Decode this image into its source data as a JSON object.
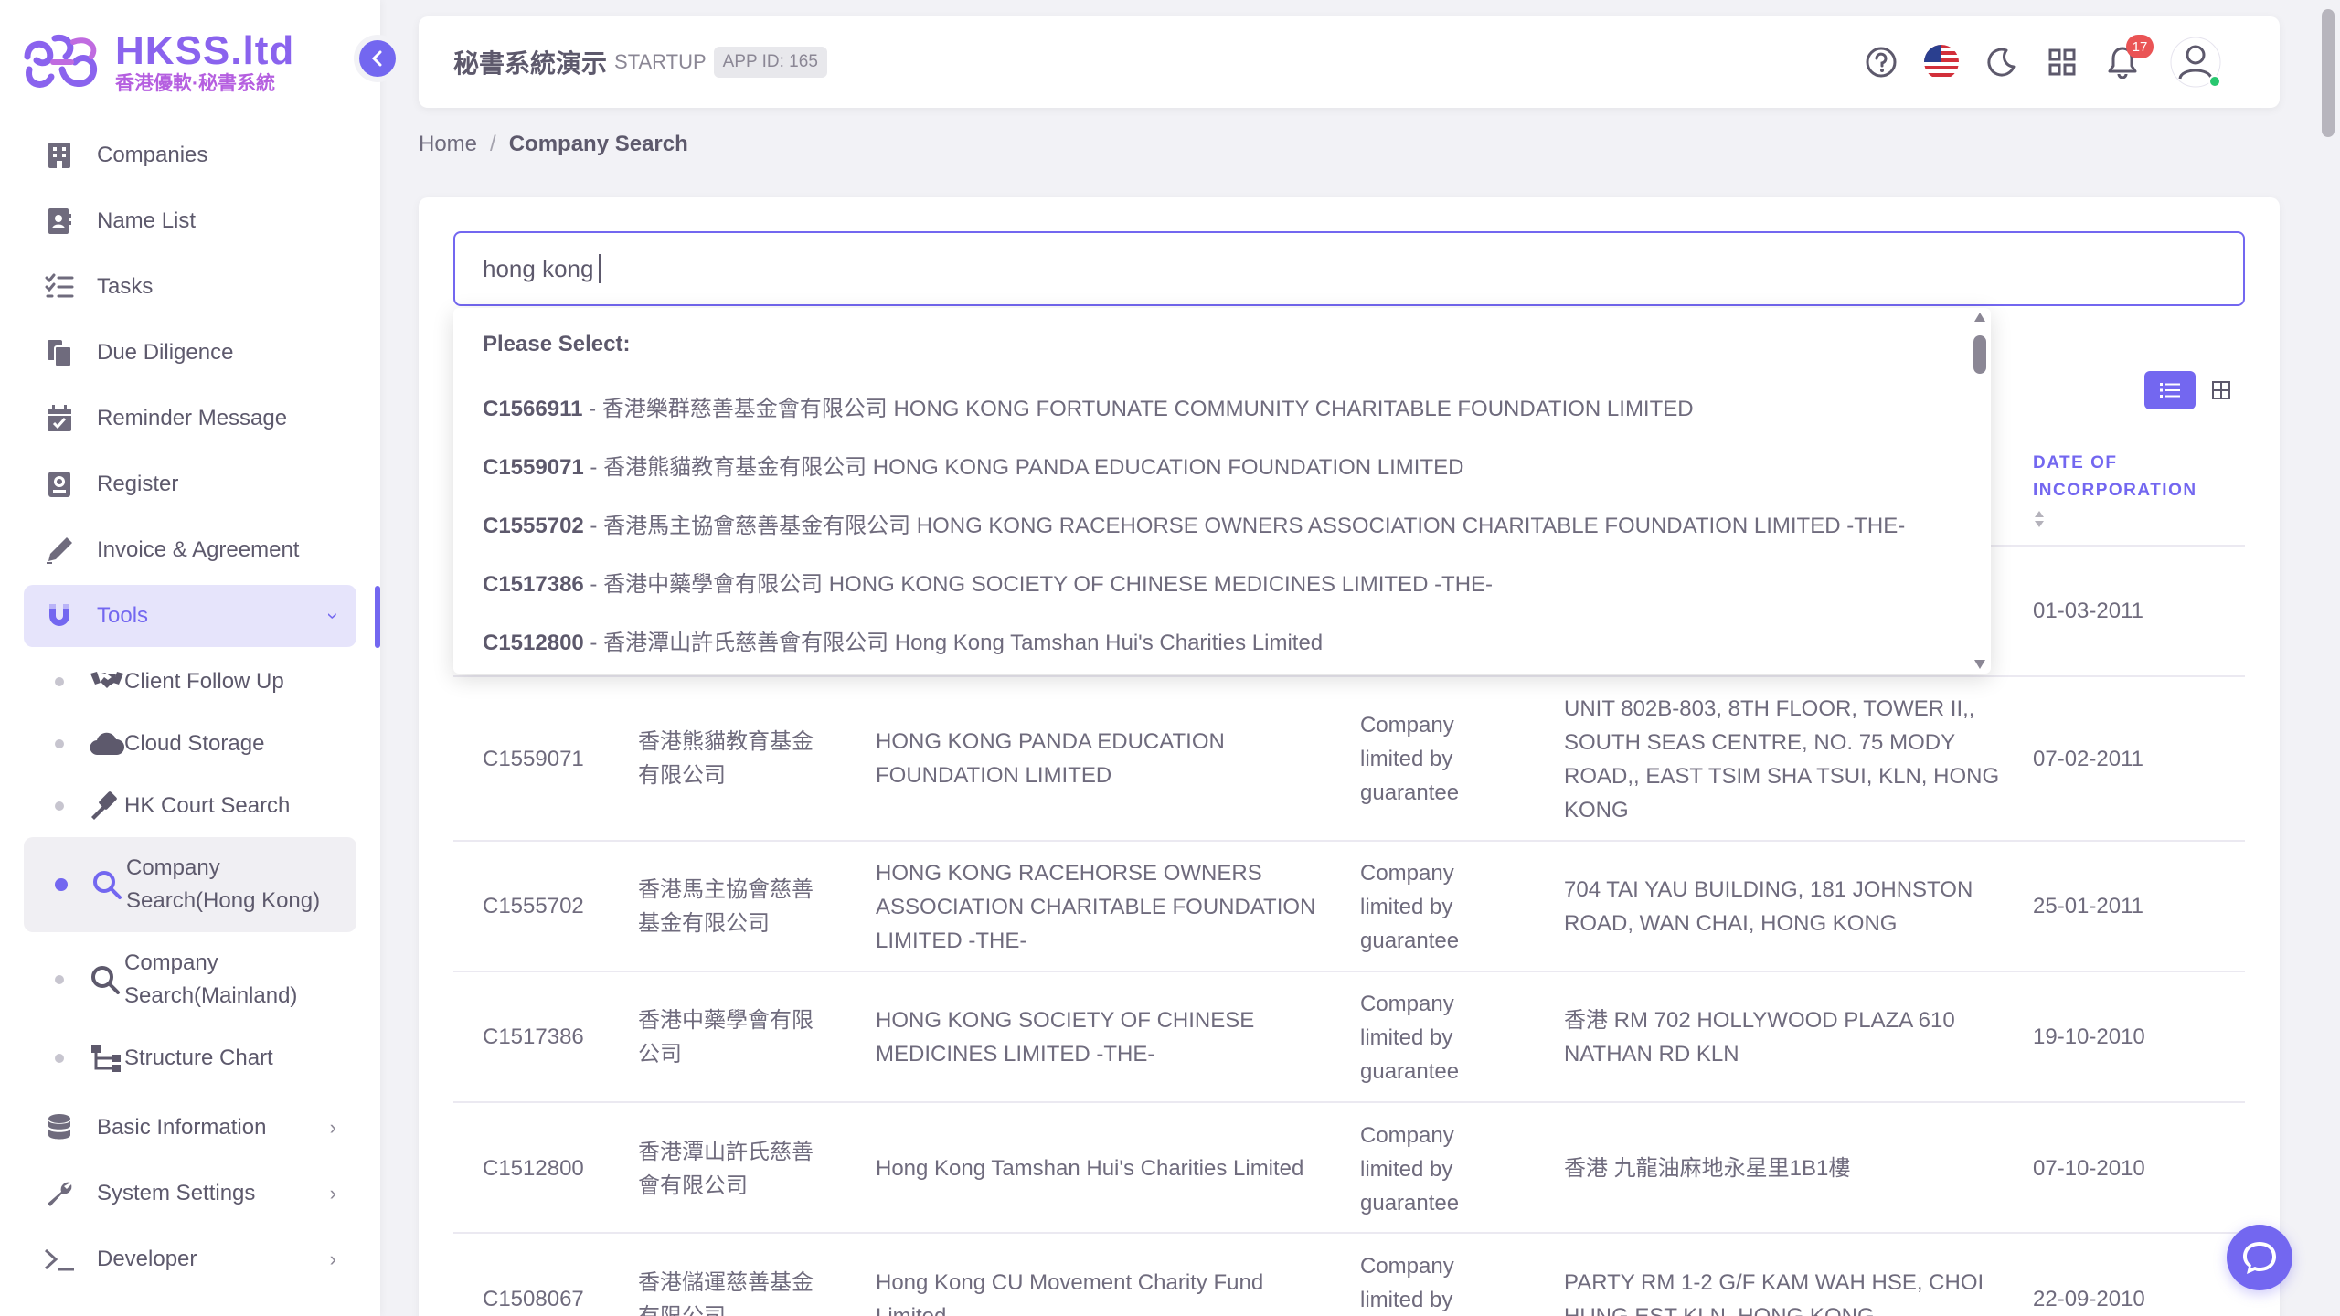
{
  "logo": {
    "title": "HKSS.ltd",
    "subtitle": "香港優軟·秘書系統"
  },
  "sidebar": {
    "items": [
      {
        "label": "Companies",
        "icon": "building-icon"
      },
      {
        "label": "Name List",
        "icon": "contact-card-icon"
      },
      {
        "label": "Tasks",
        "icon": "checklist-icon"
      },
      {
        "label": "Due Diligence",
        "icon": "documents-icon"
      },
      {
        "label": "Reminder Message",
        "icon": "calendar-check-icon"
      },
      {
        "label": "Register",
        "icon": "register-icon"
      },
      {
        "label": "Invoice & Agreement",
        "icon": "pen-icon"
      },
      {
        "label": "Tools",
        "icon": "magnet-icon"
      }
    ],
    "tools_sub": [
      {
        "label": "Client Follow Up",
        "icon": "handshake-icon"
      },
      {
        "label": "Cloud Storage",
        "icon": "cloud-icon"
      },
      {
        "label": "HK Court Search",
        "icon": "gavel-icon"
      },
      {
        "label_line1": "Company",
        "label_line2": "Search(Hong Kong)",
        "icon": "search-icon"
      },
      {
        "label_line1": "Company",
        "label_line2": "Search(Mainland)",
        "icon": "search-icon"
      },
      {
        "label": "Structure Chart",
        "icon": "sitemap-icon"
      }
    ],
    "bottom": [
      {
        "label": "Basic Information",
        "icon": "database-icon"
      },
      {
        "label": "System Settings",
        "icon": "wrench-icon"
      },
      {
        "label": "Developer",
        "icon": "terminal-icon"
      }
    ]
  },
  "topbar": {
    "title": "秘書系統演示",
    "plan": "STARTUP",
    "app_id": "APP ID: 165",
    "notifications": "17"
  },
  "breadcrumb": {
    "home": "Home",
    "separator": "/",
    "current": "Company Search"
  },
  "search": {
    "value": "hong kong"
  },
  "dropdown": {
    "header": "Please Select:",
    "items": [
      {
        "code": "C1566911",
        "text": " - 香港樂群慈善基金會有限公司 HONG KONG FORTUNATE COMMUNITY CHARITABLE FOUNDATION LIMITED"
      },
      {
        "code": "C1559071",
        "text": " - 香港熊貓教育基金有限公司 HONG KONG PANDA EDUCATION FOUNDATION LIMITED"
      },
      {
        "code": "C1555702",
        "text": " - 香港馬主協會慈善基金有限公司 HONG KONG RACEHORSE OWNERS ASSOCIATION CHARITABLE FOUNDATION LIMITED -THE-"
      },
      {
        "code": "C1517386",
        "text": " - 香港中藥學會有限公司 HONG KONG SOCIETY OF CHINESE MEDICINES LIMITED -THE-"
      },
      {
        "code": "C1512800",
        "text": " - 香港潭山許氏慈善會有限公司 Hong Kong Tamshan Hui's Charities Limited"
      }
    ]
  },
  "table": {
    "date_header_line1": "DATE OF",
    "date_header_line2": "INCORPORATION",
    "first_row_date": "01-03-2011",
    "rows": [
      {
        "no": "C1559071",
        "cn1": "香港熊貓教育基金",
        "cn2": "有限公司",
        "en1": "HONG KONG PANDA EDUCATION",
        "en2": "FOUNDATION LIMITED",
        "en3": "",
        "type1": "Company",
        "type2": "limited by",
        "type3": "guarantee",
        "addr1": "UNIT 802B-803, 8TH FLOOR, TOWER II,,",
        "addr2": "SOUTH SEAS CENTRE, NO. 75 MODY",
        "addr3": "ROAD,, EAST TSIM SHA TSUI, KLN, HONG",
        "addr4": "KONG",
        "date": "07-02-2011"
      },
      {
        "no": "C1555702",
        "cn1": "香港馬主協會慈善",
        "cn2": "基金有限公司",
        "en1": "HONG KONG RACEHORSE OWNERS",
        "en2": "ASSOCIATION CHARITABLE FOUNDATION",
        "en3": "LIMITED -THE-",
        "type1": "Company",
        "type2": "limited by",
        "type3": "guarantee",
        "addr1": "704 TAI YAU BUILDING, 181 JOHNSTON",
        "addr2": "ROAD, WAN CHAI, HONG KONG",
        "addr3": "",
        "addr4": "",
        "date": "25-01-2011"
      },
      {
        "no": "C1517386",
        "cn1": "香港中藥學會有限",
        "cn2": "公司",
        "en1": "HONG KONG SOCIETY OF CHINESE",
        "en2": "MEDICINES LIMITED -THE-",
        "en3": "",
        "type1": "Company",
        "type2": "limited by",
        "type3": "guarantee",
        "addr1": "香港 RM 702 HOLLYWOOD PLAZA 610",
        "addr2": "NATHAN RD KLN",
        "addr3": "",
        "addr4": "",
        "date": "19-10-2010"
      },
      {
        "no": "C1512800",
        "cn1": "香港潭山許氏慈善",
        "cn2": "會有限公司",
        "en1": "Hong Kong Tamshan Hui's Charities Limited",
        "en2": "",
        "en3": "",
        "type1": "Company",
        "type2": "limited by",
        "type3": "guarantee",
        "addr1": "香港 九龍油麻地永星里1B1樓",
        "addr2": "",
        "addr3": "",
        "addr4": "",
        "date": "07-10-2010"
      },
      {
        "no": "C1508067",
        "cn1": "香港儲運慈善基金",
        "cn2": "有限公司",
        "en1": "Hong Kong CU Movement Charity Fund",
        "en2": "Limited",
        "en3": "",
        "type1": "Company",
        "type2": "limited by",
        "type3": "",
        "addr1": "PARTY RM 1-2 G/F KAM WAH HSE, CHOI",
        "addr2": "HUNG EST KLN, HONG KONG",
        "addr3": "",
        "addr4": "",
        "date": "22-09-2010"
      }
    ]
  },
  "colors": {
    "accent": "#7367f0",
    "badge": "#ea5455",
    "online": "#28c76f"
  }
}
